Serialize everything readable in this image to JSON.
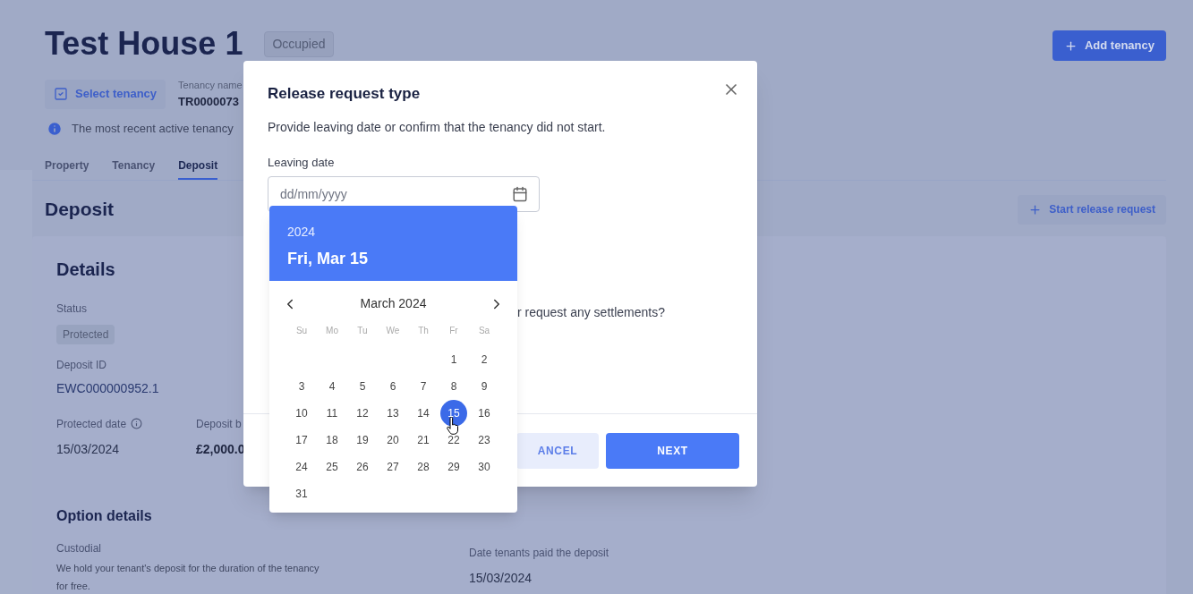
{
  "page": {
    "title": "Test House 1",
    "status_badge": "Occupied",
    "add_tenancy_button": "Add tenancy",
    "select_tenancy_button": "Select tenancy",
    "tenancy_name_label": "Tenancy name",
    "tenancy_name_value": "TR0000073",
    "info_text": "The most recent active tenancy",
    "tabs": [
      {
        "label": "Property",
        "selected": false
      },
      {
        "label": "Tenancy",
        "selected": false
      },
      {
        "label": "Deposit",
        "selected": true
      }
    ],
    "section_title": "Deposit",
    "start_release_button": "Start release request",
    "details": {
      "title": "Details",
      "status_label": "Status",
      "status_badge": "Protected",
      "deposit_id_label": "Deposit ID",
      "deposit_id": "EWC000000952.1",
      "protected_date_label": "Protected date",
      "protected_date": "15/03/2024",
      "deposit_balance_label": "Deposit b",
      "deposit_balance": "£2,000.0"
    },
    "option_details": {
      "title": "Option details",
      "type": "Custodial",
      "description": "We hold your tenant's deposit for the duration of the tenancy for free.",
      "paid_label": "Date tenants paid the deposit",
      "paid_date": "15/03/2024"
    }
  },
  "modal": {
    "title": "Release request type",
    "description": "Provide leaving date or confirm that the tenancy did not start.",
    "leaving_date_label": "Leaving date",
    "date_placeholder": "dd/mm/yyyy",
    "question_text": "r request any settlements?",
    "cancel_button": "ANCEL",
    "next_button": "NEXT"
  },
  "datepicker": {
    "year": "2024",
    "date_heading": "Fri, Mar 15",
    "month_label": "March 2024",
    "weekdays": [
      "Su",
      "Mo",
      "Tu",
      "We",
      "Th",
      "Fr",
      "Sa"
    ],
    "weeks": [
      [
        {
          "label": "1",
          "selected": false
        },
        {
          "label": "2",
          "selected": false
        }
      ],
      [
        {
          "label": "3",
          "selected": false
        },
        {
          "label": "4",
          "selected": false
        },
        {
          "label": "5",
          "selected": false
        },
        {
          "label": "6",
          "selected": false
        },
        {
          "label": "7",
          "selected": false
        },
        {
          "label": "8",
          "selected": false
        },
        {
          "label": "9",
          "selected": false
        }
      ],
      [
        {
          "label": "10",
          "selected": false
        },
        {
          "label": "11",
          "selected": false
        },
        {
          "label": "12",
          "selected": false
        },
        {
          "label": "13",
          "selected": false
        },
        {
          "label": "14",
          "selected": false
        },
        {
          "label": "15",
          "selected": true
        },
        {
          "label": "16",
          "selected": false
        }
      ],
      [
        {
          "label": "17",
          "selected": false
        },
        {
          "label": "18",
          "selected": false
        },
        {
          "label": "19",
          "selected": false
        },
        {
          "label": "20",
          "selected": false
        },
        {
          "label": "21",
          "selected": false
        },
        {
          "label": "22",
          "selected": false
        },
        {
          "label": "23",
          "selected": false
        }
      ],
      [
        {
          "label": "24",
          "selected": false
        },
        {
          "label": "25",
          "selected": false
        },
        {
          "label": "26",
          "selected": false
        },
        {
          "label": "27",
          "selected": false
        },
        {
          "label": "28",
          "selected": false
        },
        {
          "label": "29",
          "selected": false
        },
        {
          "label": "30",
          "selected": false
        }
      ],
      [
        {
          "label": "31",
          "selected": false
        }
      ]
    ]
  }
}
